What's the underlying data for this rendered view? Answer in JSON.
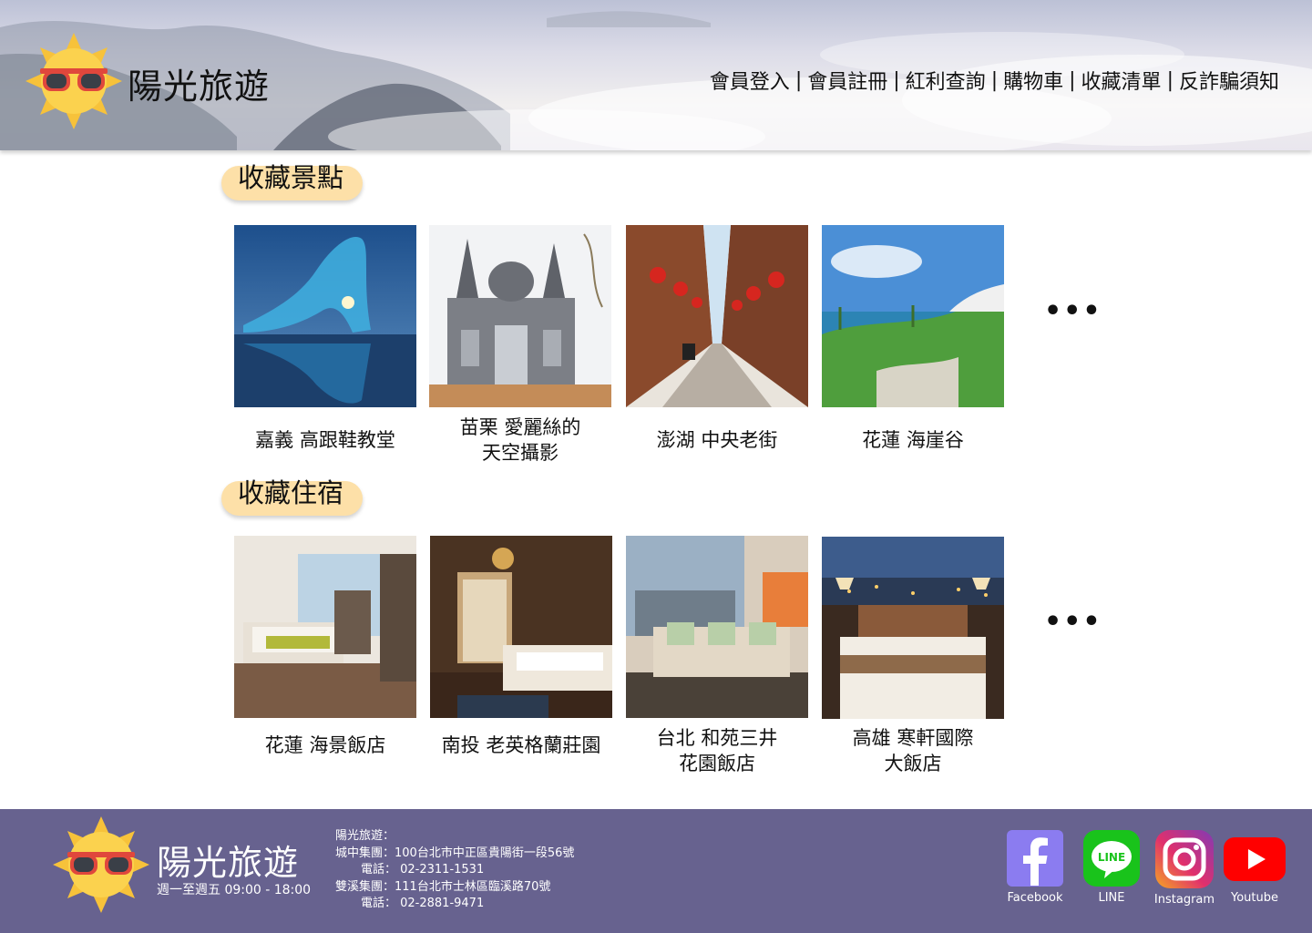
{
  "header": {
    "brand": "陽光旅遊",
    "nav": [
      {
        "label": "會員登入",
        "sep": "|"
      },
      {
        "label": "會員註冊",
        "sep": "|"
      },
      {
        "label": "紅利查詢",
        "sep": "|"
      },
      {
        "label": "購物車",
        "sep": "|"
      },
      {
        "label": "收藏清單",
        "sep": "|"
      },
      {
        "label": "反詐騙須知",
        "sep": ""
      }
    ]
  },
  "attractions": {
    "title": "收藏景點",
    "more": "•••",
    "items": [
      {
        "line1": "嘉義 高跟鞋教堂",
        "line2": ""
      },
      {
        "line1": "苗栗 愛麗絲的",
        "line2": "天空攝影"
      },
      {
        "line1": "澎湖 中央老街",
        "line2": ""
      },
      {
        "line1": "花蓮 海崖谷",
        "line2": ""
      }
    ]
  },
  "lodging": {
    "title": "收藏住宿",
    "more": "•••",
    "items": [
      {
        "line1": "花蓮 海景飯店",
        "line2": ""
      },
      {
        "line1": "南投 老英格蘭莊園",
        "line2": ""
      },
      {
        "line1": "台北 和苑三井",
        "line2": "花園飯店"
      },
      {
        "line1": "高雄 寒軒國際",
        "line2": "大飯店"
      }
    ]
  },
  "footer": {
    "brand": "陽光旅遊",
    "hours": "週一至週五 09:00 - 18:00",
    "company": "陽光旅遊：",
    "branch1": "城中集團：100台北市中正區貴陽街一段56號",
    "phone1": "電話： 02-2311-1531",
    "branch2": "雙溪集團：111台北市士林區臨溪路70號",
    "phone2": "電話： 02-2881-9471",
    "social": [
      {
        "label": "Facebook"
      },
      {
        "label": "LINE"
      },
      {
        "label": "Instagram"
      },
      {
        "label": "Youtube"
      }
    ]
  },
  "colors": {
    "footer_bg": "#67628f",
    "title_pill": "#fde0a8",
    "header_sky": "#dcdce8"
  },
  "icons": [
    "sun-sunglasses-logo-icon",
    "facebook-icon",
    "line-icon",
    "instagram-icon",
    "youtube-icon"
  ]
}
